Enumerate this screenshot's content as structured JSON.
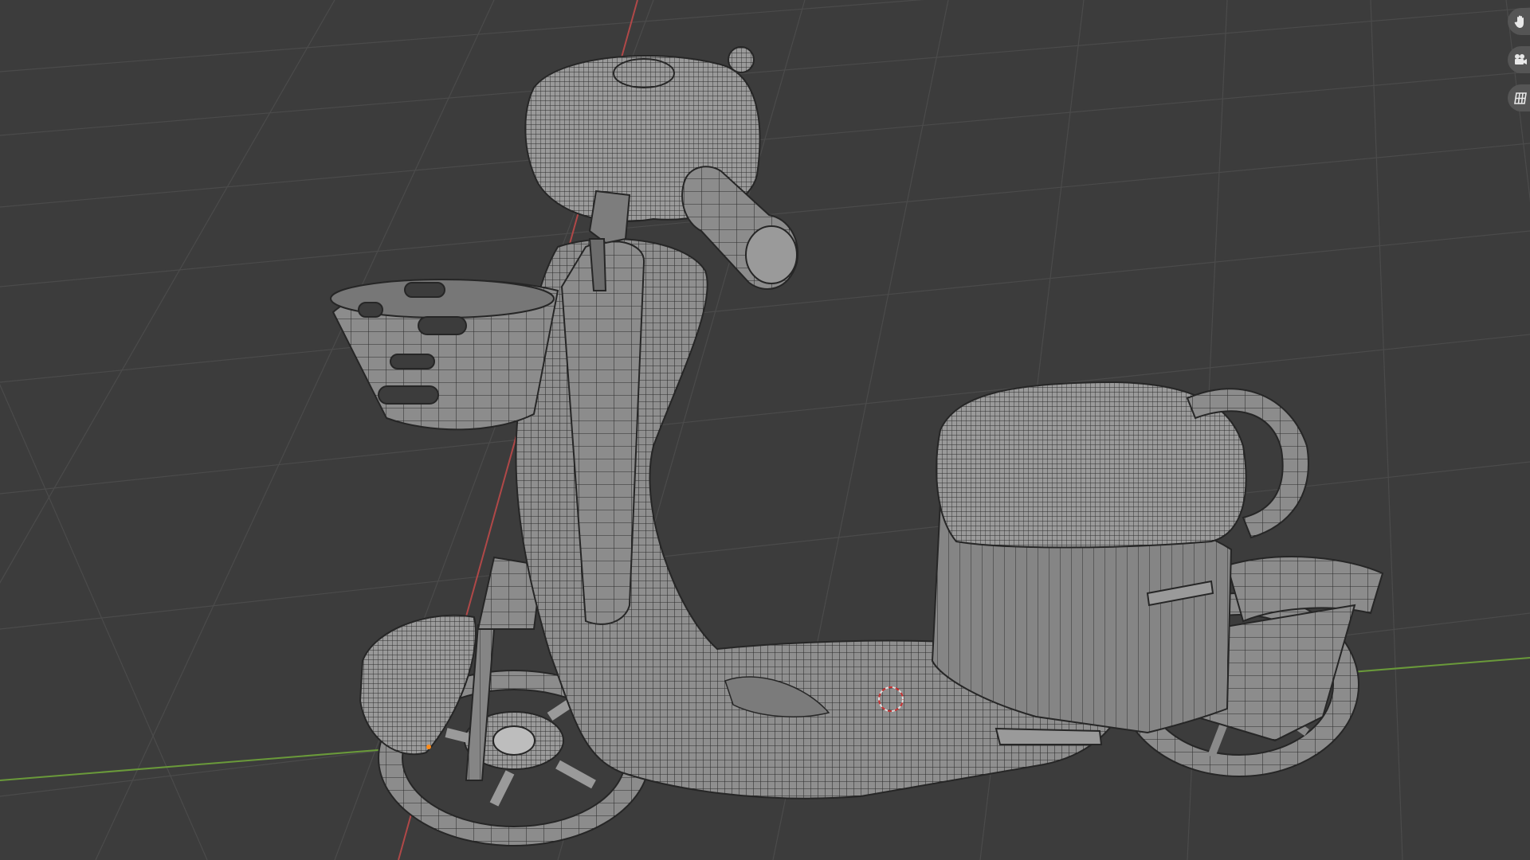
{
  "app": "Blender",
  "viewport": {
    "mode": "wireframe-overlay",
    "background_color": "#3c3c3c",
    "grid_color": "#4a4a4a",
    "x_axis_color": "#b04848",
    "y_axis_color": "#6a9a3a",
    "object": "electric-scooter-mesh",
    "mesh_color": "#8e8e8e",
    "wire_color": "#2a2a2a"
  },
  "navigation_gizmos": [
    {
      "name": "pan-view",
      "icon": "hand-icon"
    },
    {
      "name": "camera-view",
      "icon": "camera-icon"
    },
    {
      "name": "toggle-perspective",
      "icon": "grid-perspective-icon"
    }
  ]
}
